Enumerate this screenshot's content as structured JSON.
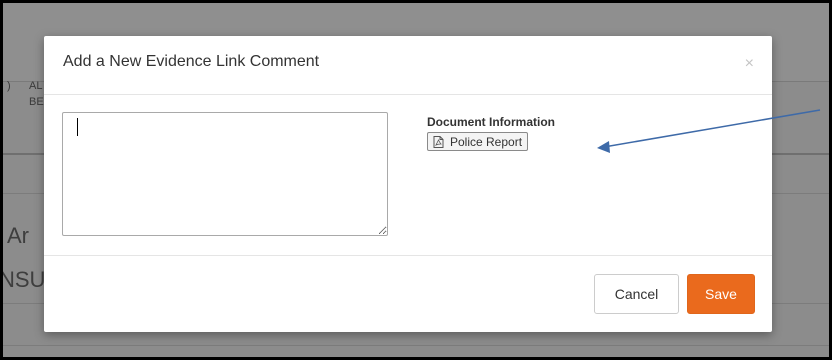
{
  "background": {
    "fragment_1": "AL",
    "fragment_2": "BE",
    "fragment_3": ")",
    "fragment_4": "Ar",
    "fragment_5": "NSU"
  },
  "modal": {
    "title": "Add a New Evidence Link Comment",
    "close_label": "×",
    "comment": {
      "value": "",
      "placeholder": ""
    },
    "document_information": {
      "label": "Document Information",
      "document_button_label": "Police Report",
      "document_icon": "pdf-file-icon"
    },
    "footer": {
      "cancel_label": "Cancel",
      "save_label": "Save"
    }
  },
  "colors": {
    "save_button": "#ea6a1d",
    "annotation_arrow": "#3e6aa8",
    "backdrop": "#8c8c8c"
  }
}
